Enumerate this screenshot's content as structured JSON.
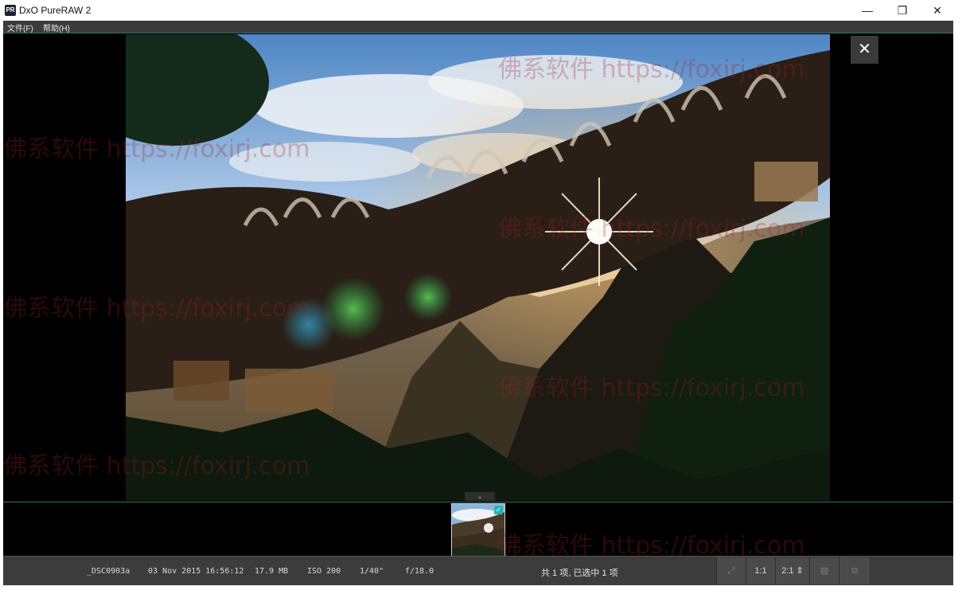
{
  "window": {
    "icon_text": "PR",
    "title": "DxO PureRAW 2",
    "minimize": "—",
    "restore": "❐",
    "close": "✕"
  },
  "menu": {
    "items": [
      {
        "label": "文件(F)"
      },
      {
        "label": "帮助(H)"
      }
    ]
  },
  "viewer": {
    "close_glyph": "✕",
    "collapse_glyph": "⌄"
  },
  "filmstrip": {
    "checked": true,
    "check_glyph": "✓"
  },
  "status": {
    "filename": "_DSC0903a",
    "datetime": "03 Nov 2015 16:56:12",
    "filesize": "17.9 MB",
    "iso": "ISO 200",
    "shutter": "1/40\"",
    "aperture": "f/18.0",
    "selection": "共 1 项, 已选中 1 项"
  },
  "toolbar": {
    "fullscreen_glyph": "⤢",
    "zoom_fit": "1:1",
    "zoom_select": "2:1 ⇕",
    "compare_glyph": "▧",
    "batch_glyph": "⧉"
  },
  "watermark": {
    "text": "佛系软件 https://foxirj.com"
  },
  "colors": {
    "accent": "#2f6f78",
    "check": "#27b3b3",
    "menubar": "#3b3b3b",
    "statusbar": "#3c3c3c"
  }
}
